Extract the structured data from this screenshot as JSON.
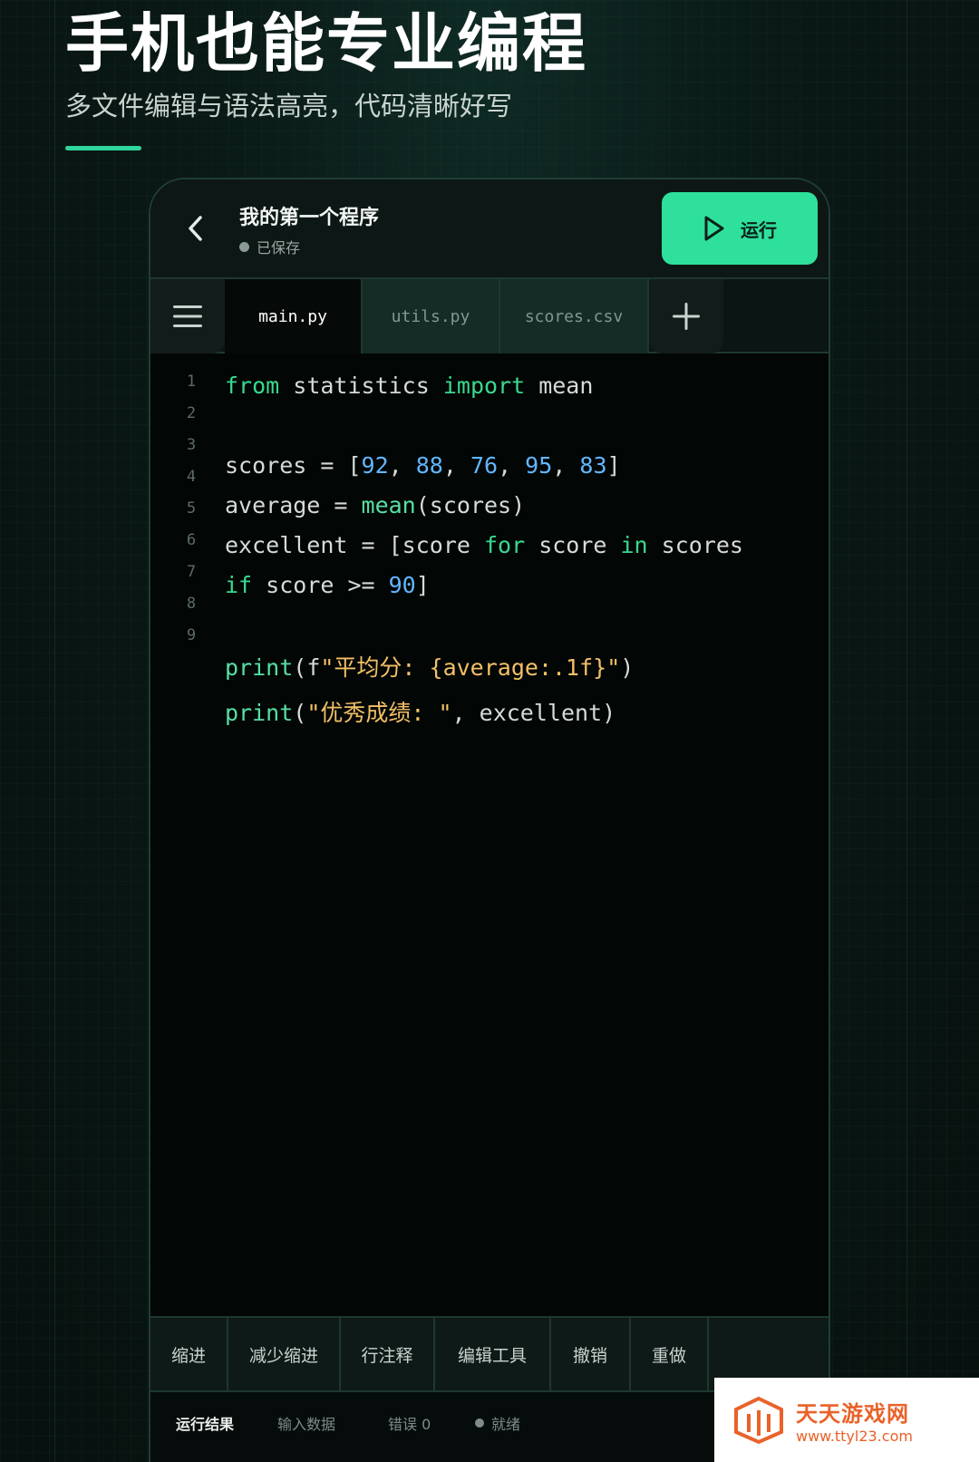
{
  "hero": {
    "title": "手机也能专业编程",
    "subtitle": "多文件编辑与语法高亮，代码清晰好写"
  },
  "editor_header": {
    "title": "我的第一个程序",
    "save_status": "已保存",
    "run_label": "运行"
  },
  "tabs": [
    {
      "label": "main.py",
      "active": true
    },
    {
      "label": "utils.py",
      "active": false
    },
    {
      "label": "scores.csv",
      "active": false
    }
  ],
  "line_numbers": [
    "1",
    "2",
    "3",
    "4",
    "5",
    "6",
    "7",
    "8",
    "9"
  ],
  "code": {
    "l1": {
      "kw1": "from",
      "t1": " statistics ",
      "kw2": "import",
      "t2": " mean"
    },
    "l3": {
      "t1": "scores = [",
      "n1": "92",
      "s1": ", ",
      "n2": "88",
      "s2": ", ",
      "n3": "76",
      "s3": ", ",
      "n4": "95",
      "s4": ", ",
      "n5": "83",
      "t2": "]"
    },
    "l4": {
      "t1": "average = ",
      "fn": "mean",
      "t2": "(scores)"
    },
    "l5": {
      "t1": "excellent = [score ",
      "kw1": "for",
      "t2": " score ",
      "kw2": "in",
      "t3": " scores"
    },
    "l6": {
      "kw1": "if",
      "t1": " score >= ",
      "n1": "90",
      "t2": "]"
    },
    "l8": {
      "fn": "print",
      "t1": "(f",
      "str": "\"平均分: {average:.1f}\"",
      "t2": ")"
    },
    "l9": {
      "fn": "print",
      "t1": "(",
      "str": "\"优秀成绩: \"",
      "t2": ", excellent)"
    }
  },
  "toolbar": [
    "缩进",
    "减少缩进",
    "行注释",
    "编辑工具",
    "撤销",
    "重做"
  ],
  "output_tabs": [
    "运行结果",
    "输入数据",
    "错误 0",
    "就绪"
  ],
  "watermark": {
    "name": "天天游戏网",
    "url": "www.ttyl23.com"
  },
  "colors": {
    "accent": "#2ee09c",
    "keyword": "#39d98e",
    "number": "#62b6ff",
    "string": "#f2c066"
  },
  "icons": {
    "back": "chevron-left-icon",
    "run": "play-icon",
    "menu": "hamburger-menu-icon",
    "add": "plus-icon"
  }
}
